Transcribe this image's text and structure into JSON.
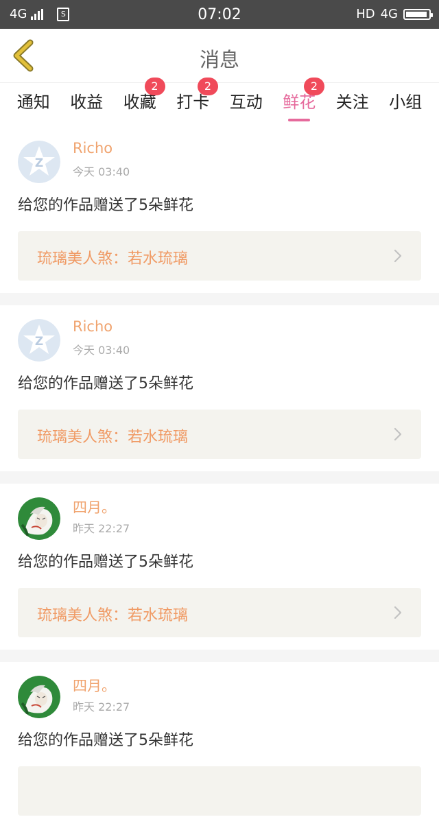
{
  "status_bar": {
    "network_left": "4G",
    "sim_label": "S",
    "time": "07:02",
    "hd_label": "HD",
    "network_right": "4G",
    "battery_level": 0.95
  },
  "header": {
    "title": "消息"
  },
  "tabs": [
    {
      "label": "通知",
      "badge": ""
    },
    {
      "label": "收益",
      "badge": ""
    },
    {
      "label": "收藏",
      "badge": "2"
    },
    {
      "label": "打卡",
      "badge": "2"
    },
    {
      "label": "互动",
      "badge": ""
    },
    {
      "label": "鲜花",
      "badge": "2"
    },
    {
      "label": "关注",
      "badge": ""
    },
    {
      "label": "小组",
      "badge": ""
    }
  ],
  "active_tab_index": 5,
  "colors": {
    "accent_pink": "#e66a9c",
    "username_orange": "#f0a36e",
    "work_title_orange": "#f09a64",
    "badge_red": "#f04a5a",
    "back_arrow_yellow": "#e2c03a"
  },
  "messages": [
    {
      "user": "Richo",
      "time": "今天 03:40",
      "avatar": "default-z-avatar",
      "text": "给您的作品赠送了5朵鲜花",
      "work": "琉璃美人煞：若水琉璃"
    },
    {
      "user": "Richo",
      "time": "今天 03:40",
      "avatar": "default-z-avatar",
      "text": "给您的作品赠送了5朵鲜花",
      "work": "琉璃美人煞：若水琉璃"
    },
    {
      "user": "四月。",
      "time": "昨天 22:27",
      "avatar": "illustration-avatar",
      "text": "给您的作品赠送了5朵鲜花",
      "work": "琉璃美人煞：若水琉璃"
    },
    {
      "user": "四月。",
      "time": "昨天 22:27",
      "avatar": "illustration-avatar",
      "text": "给您的作品赠送了5朵鲜花",
      "work": ""
    }
  ]
}
